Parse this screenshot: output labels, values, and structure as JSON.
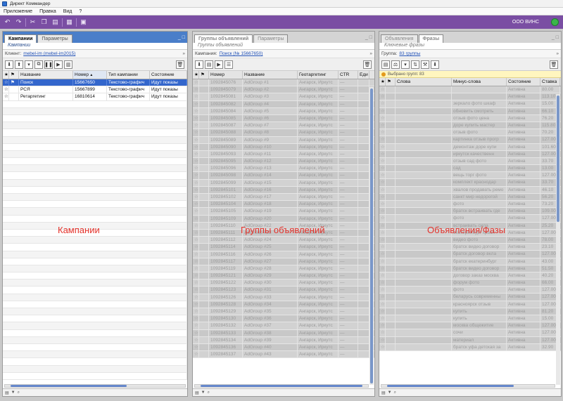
{
  "window": {
    "title": "Директ Коммандер"
  },
  "menu": [
    "Приложение",
    "Правка",
    "Вид",
    "?"
  ],
  "toolbar": {
    "company": "ООО ВИНС"
  },
  "campaigns": {
    "tabs": [
      "Кампании",
      "Параметры"
    ],
    "subtab": "Кампании",
    "client_label": "Клиент:",
    "client": "mebel-im (mebel-im2015)",
    "columns": [
      "Название",
      "Номер",
      "Тип кампании",
      "Состояние"
    ],
    "rows": [
      {
        "name": "Поиск",
        "number": "15667650",
        "type": "Текстово-графич",
        "state": "Идут показы",
        "selected": true
      },
      {
        "name": "РСЯ",
        "number": "15667899",
        "type": "Текстово-графич",
        "state": "Идут показы",
        "selected": false
      },
      {
        "name": "Ретаргетинг",
        "number": "16810614",
        "type": "Текстово-графич",
        "state": "Идут показы",
        "selected": false
      }
    ],
    "overlay": "Кампании"
  },
  "adgroups": {
    "tabs": [
      "Группы объявлений",
      "Параметры"
    ],
    "subtab": "Группы объявлений",
    "campaign_label": "Кампания:",
    "campaign": "Поиск (№ 15667650)",
    "columns": [
      "Номер",
      "Название",
      "Геотаргетинг",
      "CTR",
      "Еди"
    ],
    "geo": "Ангарск, Иркутс",
    "ctr": "—",
    "rows": [
      [
        "1092845076",
        "AdGroup #1"
      ],
      [
        "1092845079",
        "AdGroup #2"
      ],
      [
        "1092845081",
        "AdGroup #3"
      ],
      [
        "1092845082",
        "AdGroup #4"
      ],
      [
        "1092845084",
        "AdGroup #5"
      ],
      [
        "1092845085",
        "AdGroup #6"
      ],
      [
        "1092845087",
        "AdGroup #7"
      ],
      [
        "1092845088",
        "AdGroup #8"
      ],
      [
        "1092845089",
        "AdGroup #9"
      ],
      [
        "1092845090",
        "AdGroup #10"
      ],
      [
        "1092845093",
        "AdGroup #11"
      ],
      [
        "1092845095",
        "AdGroup #12"
      ],
      [
        "1092845096",
        "AdGroup #13"
      ],
      [
        "1092845098",
        "AdGroup #14"
      ],
      [
        "1092845099",
        "AdGroup #15"
      ],
      [
        "1092845101",
        "AdGroup #16"
      ],
      [
        "1092845102",
        "AdGroup #17"
      ],
      [
        "1092845104",
        "AdGroup #18"
      ],
      [
        "1092845105",
        "AdGroup #19"
      ],
      [
        "1092845109",
        "AdGroup #20"
      ],
      [
        "1092845110",
        "AdGroup #22"
      ],
      [
        "1092845111",
        "AdGroup #23"
      ],
      [
        "1092845112",
        "AdGroup #24"
      ],
      [
        "1092845114",
        "AdGroup #25"
      ],
      [
        "1092845116",
        "AdGroup #26"
      ],
      [
        "1092845117",
        "AdGroup #27"
      ],
      [
        "1092845119",
        "AdGroup #28"
      ],
      [
        "1092845121",
        "AdGroup #29"
      ],
      [
        "1092845122",
        "AdGroup #30"
      ],
      [
        "1092845123",
        "AdGroup #31"
      ],
      [
        "1092845126",
        "AdGroup #33"
      ],
      [
        "1092845128",
        "AdGroup #34"
      ],
      [
        "1092845129",
        "AdGroup #35"
      ],
      [
        "1092845130",
        "AdGroup #36"
      ],
      [
        "1092845132",
        "AdGroup #37"
      ],
      [
        "1092845133",
        "AdGroup #38"
      ],
      [
        "1092845134",
        "AdGroup #39"
      ],
      [
        "1092845136",
        "AdGroup #40"
      ],
      [
        "1092845137",
        "AdGroup #43"
      ]
    ],
    "overlay": "Группы объявлений"
  },
  "ads": {
    "tabs": [
      "Объявления",
      "Фразы"
    ],
    "subtab": "Ключевые фразы",
    "group_label": "Группа:",
    "group": "83 группы",
    "notice": "Выбрано групп: 83",
    "columns": [
      "Слова",
      "Минус-слова",
      "Состояние",
      "Ставка"
    ],
    "state": "Активна",
    "rows": [
      [
        "",
        ""
      ],
      [
        "",
        ""
      ],
      [
        "",
        "зеркало фото шкаф"
      ],
      [
        "",
        "обновить смотреть"
      ],
      [
        "",
        "отзыв фото цена"
      ],
      [
        "",
        "доре купить мастер"
      ],
      [
        "",
        "отзыв фото"
      ],
      [
        "",
        "картинка отзыв прогр"
      ],
      [
        "",
        "демонтаж доре купи"
      ],
      [
        "",
        "иркутск качественн"
      ],
      [
        "",
        "отзыв сад фото"
      ],
      [
        "",
        "сад"
      ],
      [
        "",
        "вещь торг фото"
      ],
      [
        "",
        "комплект краснодар"
      ],
      [
        "",
        "хвалов продавать ремо"
      ],
      [
        "",
        "санкт мир недорогой"
      ],
      [
        "",
        "фото"
      ],
      [
        "",
        "братск встраивать где"
      ],
      [
        "",
        "фото"
      ],
      [
        "",
        "встраивать сила"
      ],
      [
        "",
        "екатеринбург красн"
      ],
      [
        "",
        "видео фото"
      ],
      [
        "",
        "братск видео договор"
      ],
      [
        "",
        "братск договор вкла"
      ],
      [
        "",
        "братск екатеринбург"
      ],
      [
        "",
        "братск видео договор"
      ],
      [
        "",
        "договор заказ москва"
      ],
      [
        "",
        "форум фото"
      ],
      [
        "",
        "фото"
      ],
      [
        "",
        "беларусь современны"
      ],
      [
        "",
        "красноярск отзыв"
      ],
      [
        "",
        "купить"
      ],
      [
        "",
        "купить"
      ],
      [
        "",
        "москва общежитие"
      ],
      [
        "",
        "сочи"
      ],
      [
        "",
        "материал"
      ],
      [
        "",
        "братск уфа детская за"
      ]
    ],
    "bids": [
      "80.00",
      "113.10",
      "15.00",
      "66.10",
      "76.20",
      "115.80",
      "70.20",
      "127.00",
      "101.60",
      "127.00",
      "33.70",
      "13.00",
      "127.00",
      "33.70",
      "46.10",
      "56.20",
      "73.20",
      "109.00",
      "127.00",
      "25.20",
      "127.00",
      "78.00",
      "23.10",
      "127.00",
      "43.00",
      "51.50",
      "40.20",
      "66.00",
      "127.00",
      "127.00",
      "127.00",
      "81.20",
      "15.00",
      "127.00",
      "127.00",
      "127.00",
      "32.90"
    ],
    "overlay": "Объявления/Фазы"
  },
  "colors": {
    "accent": "#7a4ea3",
    "selection": "#3366cc",
    "overlay_text": "#e4322b",
    "status_ok": "#3bb54a"
  }
}
